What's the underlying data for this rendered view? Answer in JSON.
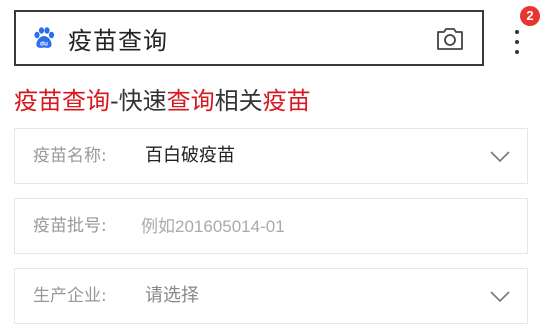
{
  "search": {
    "query": "疫苗查询",
    "logo_icon": "baidu-paw-icon",
    "camera_icon": "camera-icon"
  },
  "menu": {
    "more_icon": "more-vertical-icon",
    "badge_count": "2"
  },
  "title": {
    "part1": "疫苗查询",
    "part2": "-快速",
    "part3": "查询",
    "part4": "相关",
    "part5": "疫苗"
  },
  "form": {
    "vaccine_name": {
      "label": "疫苗名称:",
      "value": "百白破疫苗"
    },
    "batch_number": {
      "label": "疫苗批号:",
      "placeholder": "例如201605014-01"
    },
    "manufacturer": {
      "label": "生产企业:",
      "value": "请选择"
    }
  },
  "colors": {
    "highlight": "#d7171e",
    "badge": "#e8352d",
    "baidu_blue": "#2d6ef0"
  }
}
